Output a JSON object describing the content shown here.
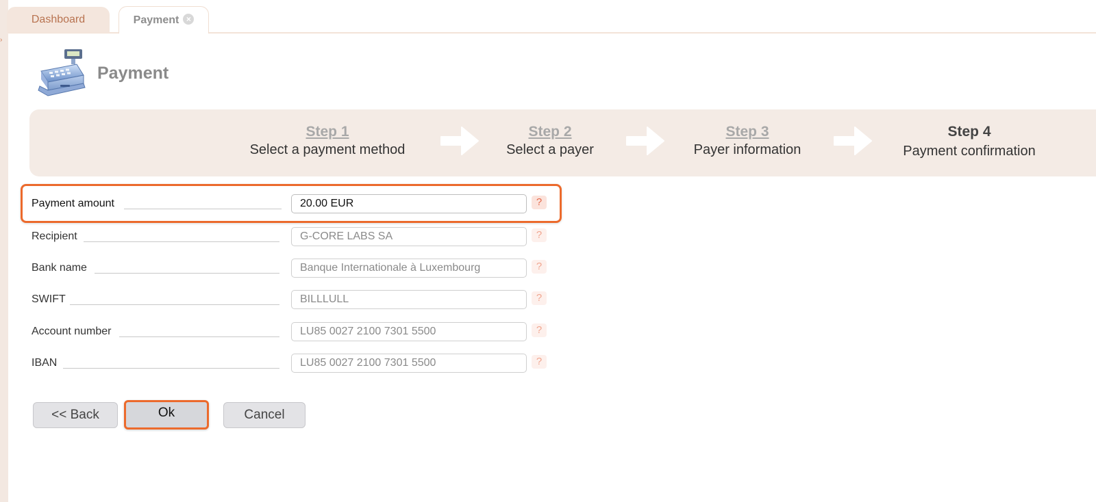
{
  "tabs": [
    {
      "label": "Dashboard"
    },
    {
      "label": "Payment",
      "close_icon": "close-icon"
    }
  ],
  "page": {
    "title": "Payment",
    "icon": "cash-register-icon"
  },
  "steps": [
    {
      "title": "Step 1",
      "desc": "Select a payment method",
      "state": "done"
    },
    {
      "title": "Step 2",
      "desc": "Select a payer",
      "state": "done"
    },
    {
      "title": "Step 3",
      "desc": "Payer information",
      "state": "done"
    },
    {
      "title": "Step 4",
      "desc": "Payment confirmation",
      "state": "current"
    }
  ],
  "form": {
    "fields": [
      {
        "label": "Payment amount",
        "value": "20.00 EUR"
      },
      {
        "label": "Recipient",
        "value": "G-CORE LABS SA"
      },
      {
        "label": "Bank name",
        "value": "Banque Internationale à Luxembourg"
      },
      {
        "label": "SWIFT",
        "value": "BILLLULL"
      },
      {
        "label": "Account number",
        "value": "LU85 0027 2100 7301 5500"
      },
      {
        "label": "IBAN",
        "value": "LU85 0027 2100 7301 5500"
      }
    ],
    "help_glyph": "?"
  },
  "buttons": {
    "back": "<< Back",
    "ok": "Ok",
    "cancel": "Cancel"
  },
  "colors": {
    "accent": "#ec6a2c",
    "tab_bg": "#f4e6dd",
    "panel_bg": "#f4ebe5"
  }
}
